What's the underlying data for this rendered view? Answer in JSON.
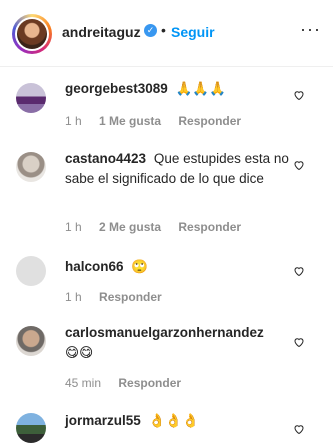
{
  "header": {
    "username": "andreitaguz",
    "follow_label": "Seguir",
    "dot": "•",
    "more": "···"
  },
  "comments": [
    {
      "user": "georgebest3089",
      "text": "🙏🙏🙏",
      "time": "1 h",
      "likes": "1 Me gusta",
      "reply": "Responder"
    },
    {
      "user": "castano4423",
      "text": "Que estupides esta no sabe el significado de lo que dice",
      "time": "1 h",
      "likes": "2 Me gusta",
      "reply": "Responder"
    },
    {
      "user": "halcon66",
      "text": "🙄",
      "time": "1 h",
      "likes": "",
      "reply": "Responder"
    },
    {
      "user": "carlosmanuelgarzonhernandez",
      "text": "😋😋",
      "time": "45 min",
      "likes": "",
      "reply": "Responder"
    },
    {
      "user": "jormarzul55",
      "text": "👌👌👌",
      "time": "",
      "likes": "",
      "reply": ""
    }
  ],
  "colors": {
    "link_blue": "#0095f6",
    "meta_gray": "#8e8e8e",
    "text": "#262626"
  }
}
